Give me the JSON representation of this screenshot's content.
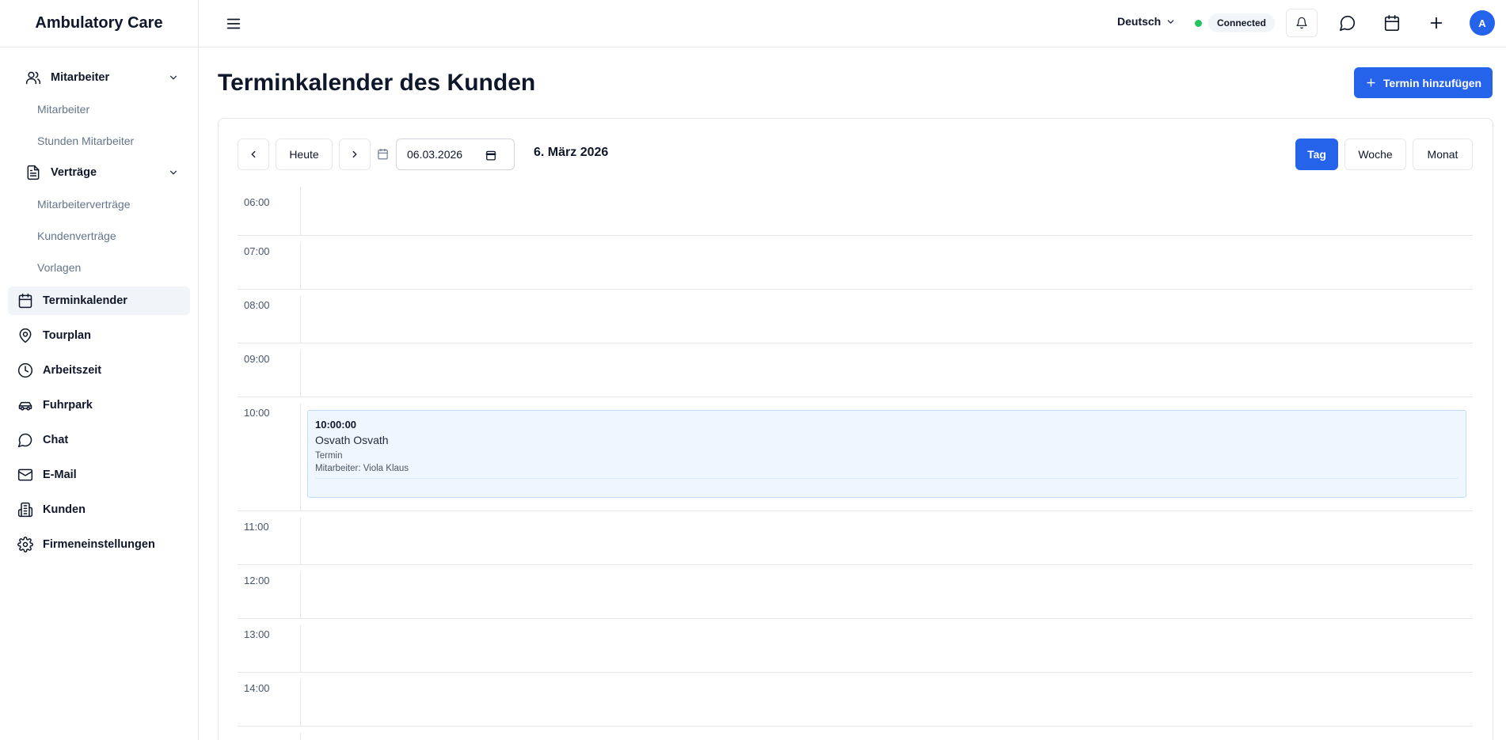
{
  "app": {
    "title": "Ambulatory Care"
  },
  "sidebar": {
    "groups": [
      {
        "label": "Mitarbeiter",
        "icon": "users-icon",
        "children": [
          "Mitarbeiter",
          "Stunden Mitarbeiter"
        ]
      },
      {
        "label": "Verträge",
        "icon": "document-icon",
        "children": [
          "Mitarbeiterverträge",
          "Kundenverträge",
          "Vorlagen"
        ]
      }
    ],
    "items": [
      {
        "label": "Terminkalender",
        "icon": "calendar-icon",
        "active": true
      },
      {
        "label": "Tourplan",
        "icon": "map-pin-icon"
      },
      {
        "label": "Arbeitszeit",
        "icon": "clock-icon"
      },
      {
        "label": "Fuhrpark",
        "icon": "car-icon"
      },
      {
        "label": "Chat",
        "icon": "chat-icon"
      },
      {
        "label": "E-Mail",
        "icon": "mail-icon"
      },
      {
        "label": "Kunden",
        "icon": "building-icon"
      },
      {
        "label": "Firmeneinstellungen",
        "icon": "gear-icon"
      }
    ]
  },
  "header": {
    "language": "Deutsch",
    "connection_status": "Connected",
    "avatar_initial": "A",
    "status_color": "#22c55e"
  },
  "main": {
    "title": "Terminkalender des Kunden",
    "add_button": "Termin hinzufügen",
    "accent_color": "#2563eb"
  },
  "toolbar": {
    "today": "Heute",
    "date_value": "06.03.2026",
    "current_date": "6. März 2026",
    "views": [
      "Tag",
      "Woche",
      "Monat"
    ],
    "active_view": "Tag"
  },
  "calendar": {
    "hours": [
      "06:00",
      "07:00",
      "08:00",
      "09:00",
      "10:00",
      "11:00",
      "12:00",
      "13:00",
      "14:00"
    ],
    "event": {
      "time": "10:00:00",
      "name": "Osvath Osvath",
      "type": "Termin",
      "staff": "Mitarbeiter: Viola Klaus"
    }
  }
}
